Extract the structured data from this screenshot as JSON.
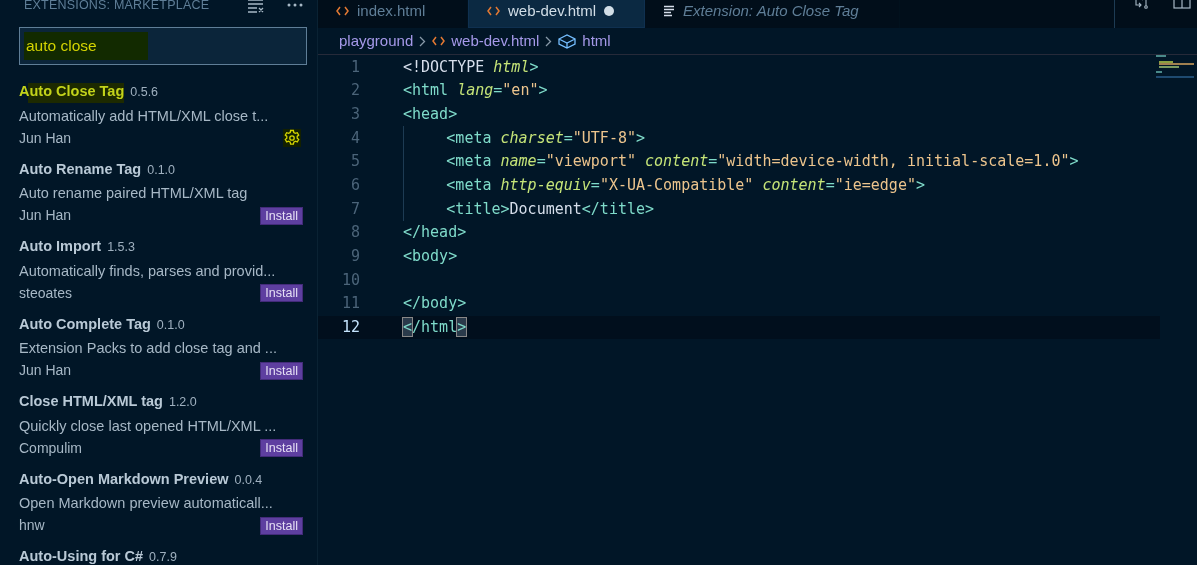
{
  "sidebar": {
    "title": "EXTENSIONS: MARKETPLACE",
    "search": {
      "value": "auto close",
      "highlighted": true
    },
    "extensions": [
      {
        "name": "Auto Close Tag",
        "version": "0.5.6",
        "description": "Automatically add HTML/XML close t...",
        "publisher": "Jun Han",
        "kind": "installed",
        "highlighted": true
      },
      {
        "name": "Auto Rename Tag",
        "version": "0.1.0",
        "description": "Auto rename paired HTML/XML tag",
        "publisher": "Jun Han",
        "kind": "available",
        "action_label": "Install",
        "highlighted": false
      },
      {
        "name": "Auto Import",
        "version": "1.5.3",
        "description": "Automatically finds, parses and provid...",
        "publisher": "steoates",
        "kind": "available",
        "action_label": "Install",
        "highlighted": false
      },
      {
        "name": "Auto Complete Tag",
        "version": "0.1.0",
        "description": "Extension Packs to add close tag and ...",
        "publisher": "Jun Han",
        "kind": "available",
        "action_label": "Install",
        "highlighted": false
      },
      {
        "name": "Close HTML/XML tag",
        "version": "1.2.0",
        "description": "Quickly close last opened HTML/XML ...",
        "publisher": "Compulim",
        "kind": "available",
        "action_label": "Install",
        "highlighted": false
      },
      {
        "name": "Auto-Open Markdown Preview",
        "version": "0.0.4",
        "description": "Open Markdown preview automaticall...",
        "publisher": "hnw",
        "kind": "available",
        "action_label": "Install",
        "highlighted": false
      },
      {
        "name": "Auto-Using for C#",
        "version": "0.7.9",
        "kind": "partial",
        "highlighted": false
      }
    ]
  },
  "tabs": [
    {
      "label": "index.html",
      "kind": "code",
      "selected": false,
      "modified": false,
      "preview": false
    },
    {
      "label": "web-dev.html",
      "kind": "code",
      "selected": true,
      "modified": true,
      "preview": false
    },
    {
      "label": "Extension: Auto Close Tag",
      "kind": "doc",
      "selected": false,
      "modified": false,
      "preview": true
    }
  ],
  "breadcrumb": [
    {
      "label": "playground",
      "kind": "folder"
    },
    {
      "label": "web-dev.html",
      "kind": "file"
    },
    {
      "label": "html",
      "kind": "element"
    }
  ],
  "code": [
    {
      "number": "1",
      "current": false,
      "indented": false,
      "tokens": [
        {
          "t": "<!DOCTYPE ",
          "kind": "plain"
        },
        {
          "t": "html",
          "kind": "attr"
        },
        {
          "t": ">",
          "kind": "tag"
        }
      ]
    },
    {
      "number": "2",
      "current": false,
      "indented": false,
      "tokens": [
        {
          "t": "<html ",
          "kind": "tag"
        },
        {
          "t": "lang",
          "kind": "attr"
        },
        {
          "t": "=",
          "kind": "tag"
        },
        {
          "t": "\"en\"",
          "kind": "str"
        },
        {
          "t": ">",
          "kind": "tag"
        }
      ]
    },
    {
      "number": "3",
      "current": false,
      "indented": false,
      "tokens": [
        {
          "t": "<head>",
          "kind": "tag"
        }
      ]
    },
    {
      "number": "4",
      "current": false,
      "indented": true,
      "tokens": [
        {
          "t": "<meta ",
          "kind": "tag"
        },
        {
          "t": "charset",
          "kind": "attr"
        },
        {
          "t": "=",
          "kind": "tag"
        },
        {
          "t": "\"UTF-8\"",
          "kind": "str"
        },
        {
          "t": ">",
          "kind": "tag"
        }
      ]
    },
    {
      "number": "5",
      "current": false,
      "indented": true,
      "tokens": [
        {
          "t": "<meta ",
          "kind": "tag"
        },
        {
          "t": "name",
          "kind": "attr"
        },
        {
          "t": "=",
          "kind": "tag"
        },
        {
          "t": "\"viewport\" ",
          "kind": "str"
        },
        {
          "t": "content",
          "kind": "attr"
        },
        {
          "t": "=",
          "kind": "tag"
        },
        {
          "t": "\"width=device-width, initial-scale=1.0\"",
          "kind": "str"
        },
        {
          "t": ">",
          "kind": "tag"
        }
      ]
    },
    {
      "number": "6",
      "current": false,
      "indented": true,
      "tokens": [
        {
          "t": "<meta ",
          "kind": "tag"
        },
        {
          "t": "http-equiv",
          "kind": "attr"
        },
        {
          "t": "=",
          "kind": "tag"
        },
        {
          "t": "\"X-UA-Compatible\" ",
          "kind": "str"
        },
        {
          "t": "content",
          "kind": "attr"
        },
        {
          "t": "=",
          "kind": "tag"
        },
        {
          "t": "\"ie=edge\"",
          "kind": "str"
        },
        {
          "t": ">",
          "kind": "tag"
        }
      ]
    },
    {
      "number": "7",
      "current": false,
      "indented": true,
      "tokens": [
        {
          "t": "<title>",
          "kind": "tag"
        },
        {
          "t": "Document",
          "kind": "plain"
        },
        {
          "t": "</title>",
          "kind": "tag"
        }
      ]
    },
    {
      "number": "8",
      "current": false,
      "indented": false,
      "tokens": [
        {
          "t": "</head>",
          "kind": "tag"
        }
      ]
    },
    {
      "number": "9",
      "current": false,
      "indented": false,
      "tokens": [
        {
          "t": "<body>",
          "kind": "tag"
        }
      ]
    },
    {
      "number": "10",
      "current": false,
      "indented": false
    },
    {
      "number": "11",
      "current": false,
      "indented": false,
      "tokens": [
        {
          "t": "</body>",
          "kind": "tag"
        }
      ]
    },
    {
      "number": "12",
      "current": true,
      "indented": false,
      "tokens": [
        {
          "t": "<",
          "kind": "tag",
          "match": true
        },
        {
          "t": "/html",
          "kind": "tag",
          "match": false
        },
        {
          "t": ">",
          "kind": "tag",
          "match": true
        }
      ]
    }
  ]
}
